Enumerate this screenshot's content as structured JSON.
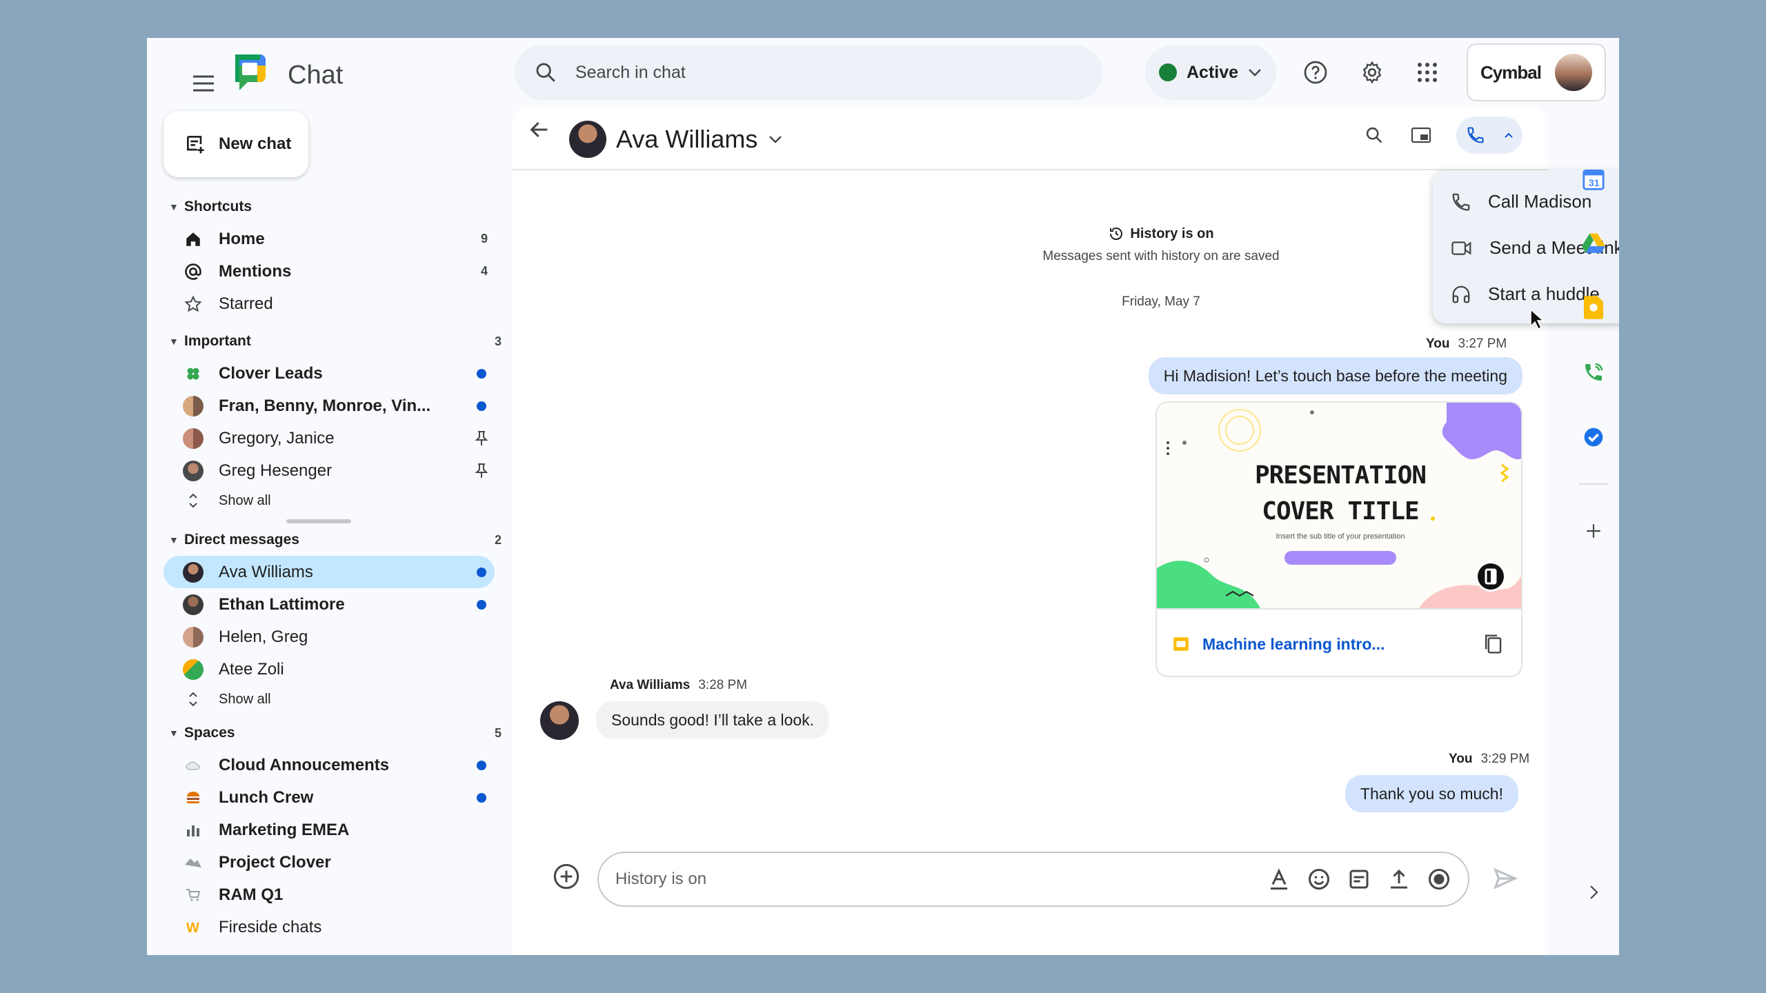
{
  "app": {
    "title": "Chat"
  },
  "search": {
    "placeholder": "Search in chat"
  },
  "status": {
    "label": "Active",
    "color": "#188038"
  },
  "account": {
    "brand": "Cymbal"
  },
  "new_chat": {
    "label": "New chat"
  },
  "sidebar": {
    "shortcuts": {
      "title": "Shortcuts",
      "items": [
        {
          "label": "Home",
          "count": "9",
          "icon": "home-icon"
        },
        {
          "label": "Mentions",
          "count": "4",
          "icon": "at-icon"
        },
        {
          "label": "Starred",
          "count": "",
          "icon": "star-icon"
        }
      ]
    },
    "important": {
      "title": "Important",
      "count": "3",
      "items": [
        {
          "label": "Clover Leads",
          "unread": true
        },
        {
          "label": "Fran, Benny, Monroe, Vin...",
          "unread": true
        },
        {
          "label": "Gregory, Janice",
          "pinned": true
        },
        {
          "label": "Greg Hesenger",
          "pinned": true
        }
      ],
      "show_all": "Show all"
    },
    "direct_messages": {
      "title": "Direct messages",
      "count": "2",
      "items": [
        {
          "label": "Ava Williams",
          "unread": true,
          "selected": true
        },
        {
          "label": "Ethan Lattimore",
          "unread": true
        },
        {
          "label": "Helen, Greg"
        },
        {
          "label": "Atee Zoli"
        }
      ],
      "show_all": "Show all"
    },
    "spaces": {
      "title": "Spaces",
      "count": "5",
      "items": [
        {
          "label": "Cloud Annoucements",
          "unread": true
        },
        {
          "label": "Lunch Crew",
          "unread": true
        },
        {
          "label": "Marketing EMEA"
        },
        {
          "label": "Project Clover"
        },
        {
          "label": "RAM Q1"
        },
        {
          "label": "Fireside chats"
        }
      ]
    }
  },
  "conversation": {
    "peer_name": "Ava Williams",
    "history_title": "History is on",
    "history_subtitle": "Messages sent with history on are saved",
    "date": "Friday, May 7",
    "messages": [
      {
        "sender": "You",
        "time": "3:27 PM",
        "text": "Hi Madision! Let’s touch base before the meeting"
      },
      {
        "sender": "Ava Williams",
        "time": "3:28 PM",
        "text": "Sounds good! I’ll take a look."
      },
      {
        "sender": "You",
        "time": "3:29 PM",
        "text": "Thank you so much!"
      }
    ],
    "attachment": {
      "title_line1": "PRESENTATION",
      "title_line2": "COVER TITLE",
      "subtitle": "Insert the sub title of your presentation",
      "file_name": "Machine learning intro..."
    },
    "composer_placeholder": "History is on"
  },
  "call_menu": {
    "items": [
      {
        "label": "Call Madison",
        "icon": "phone-icon"
      },
      {
        "label": "Send a Meet link",
        "icon": "video-icon"
      },
      {
        "label": "Start a huddle",
        "icon": "headphones-icon"
      }
    ]
  },
  "colors": {
    "unread_dot": "#0b57d0",
    "selected_row": "#c2e7ff",
    "my_bubble": "#d3e3fd"
  }
}
